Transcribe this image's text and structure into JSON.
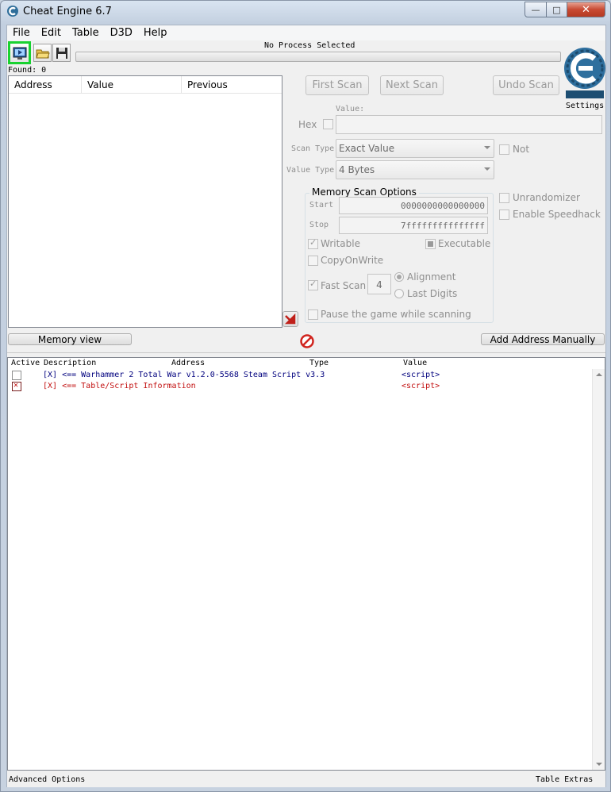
{
  "window": {
    "title": "Cheat Engine 6.7",
    "minimize_glyph": "—",
    "maximize_glyph": "□",
    "close_glyph": "✕"
  },
  "menu": [
    "File",
    "Edit",
    "Table",
    "D3D",
    "Help"
  ],
  "toolbar": {
    "icons": [
      "select-process-icon",
      "open-folder-icon",
      "save-disk-icon"
    ]
  },
  "process": {
    "name": "No Process Selected",
    "progress": 0
  },
  "results": {
    "found_label": "Found: 0",
    "columns": [
      "Address",
      "Value",
      "Previous"
    ]
  },
  "logo": {
    "settings_label": "Settings"
  },
  "scan": {
    "first_scan": "First Scan",
    "next_scan": "Next Scan",
    "undo_scan": "Undo Scan",
    "value_label": "Value:",
    "hex_label": "Hex",
    "scan_type_label": "Scan Type",
    "scan_type_value": "Exact Value",
    "not_label": "Not",
    "value_type_label": "Value Type",
    "value_type_value": "4 Bytes"
  },
  "memory_options": {
    "title": "Memory Scan Options",
    "start_label": "Start",
    "start_value": "0000000000000000",
    "stop_label": "Stop",
    "stop_value": "7fffffffffffffff",
    "writable": "Writable",
    "executable": "Executable",
    "copy_on_write": "CopyOnWrite",
    "fast_scan": "Fast Scan",
    "fast_scan_value": "4",
    "alignment": "Alignment",
    "last_digits": "Last Digits",
    "pause_game": "Pause the game while scanning"
  },
  "extras": {
    "unrandomizer": "Unrandomizer",
    "enable_speedhack": "Enable Speedhack"
  },
  "buttons": {
    "memory_view": "Memory view",
    "add_address_manually": "Add Address Manually"
  },
  "address_list": {
    "columns": [
      "Active",
      "Description",
      "Address",
      "Type",
      "Value"
    ],
    "rows": [
      {
        "active": false,
        "description": "[X] <== Warhammer 2 Total War v1.2.0-5568 Steam Script v3.3",
        "address": "",
        "type": "",
        "value": "<script>",
        "color": "#00007e"
      },
      {
        "active": true,
        "description": "[X] <== Table/Script Information",
        "address": "",
        "type": "",
        "value": "<script>",
        "color": "#c21010"
      }
    ]
  },
  "status": {
    "advanced_options": "Advanced Options",
    "table_extras": "Table Extras"
  }
}
